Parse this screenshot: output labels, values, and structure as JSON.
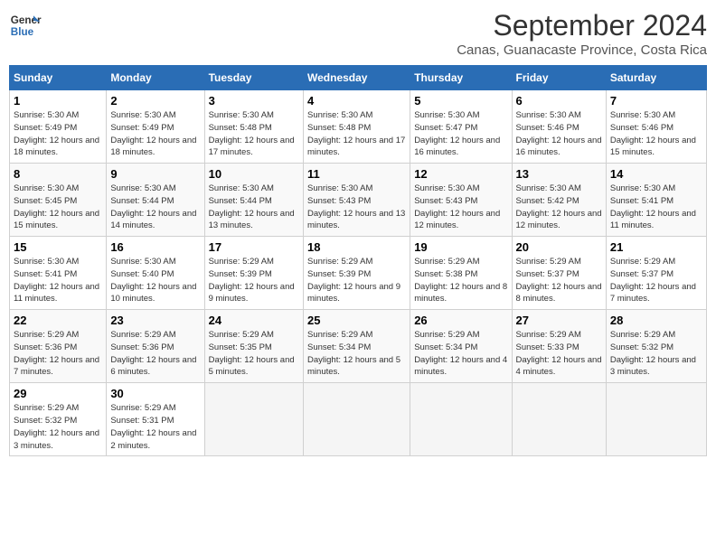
{
  "header": {
    "logo_line1": "General",
    "logo_line2": "Blue",
    "title": "September 2024",
    "subtitle": "Canas, Guanacaste Province, Costa Rica"
  },
  "calendar": {
    "days_of_week": [
      "Sunday",
      "Monday",
      "Tuesday",
      "Wednesday",
      "Thursday",
      "Friday",
      "Saturday"
    ],
    "weeks": [
      [
        {
          "day": "1",
          "sunrise": "5:30 AM",
          "sunset": "5:49 PM",
          "daylight": "12 hours and 18 minutes."
        },
        {
          "day": "2",
          "sunrise": "5:30 AM",
          "sunset": "5:49 PM",
          "daylight": "12 hours and 18 minutes."
        },
        {
          "day": "3",
          "sunrise": "5:30 AM",
          "sunset": "5:48 PM",
          "daylight": "12 hours and 17 minutes."
        },
        {
          "day": "4",
          "sunrise": "5:30 AM",
          "sunset": "5:48 PM",
          "daylight": "12 hours and 17 minutes."
        },
        {
          "day": "5",
          "sunrise": "5:30 AM",
          "sunset": "5:47 PM",
          "daylight": "12 hours and 16 minutes."
        },
        {
          "day": "6",
          "sunrise": "5:30 AM",
          "sunset": "5:46 PM",
          "daylight": "12 hours and 16 minutes."
        },
        {
          "day": "7",
          "sunrise": "5:30 AM",
          "sunset": "5:46 PM",
          "daylight": "12 hours and 15 minutes."
        }
      ],
      [
        {
          "day": "8",
          "sunrise": "5:30 AM",
          "sunset": "5:45 PM",
          "daylight": "12 hours and 15 minutes."
        },
        {
          "day": "9",
          "sunrise": "5:30 AM",
          "sunset": "5:44 PM",
          "daylight": "12 hours and 14 minutes."
        },
        {
          "day": "10",
          "sunrise": "5:30 AM",
          "sunset": "5:44 PM",
          "daylight": "12 hours and 13 minutes."
        },
        {
          "day": "11",
          "sunrise": "5:30 AM",
          "sunset": "5:43 PM",
          "daylight": "12 hours and 13 minutes."
        },
        {
          "day": "12",
          "sunrise": "5:30 AM",
          "sunset": "5:43 PM",
          "daylight": "12 hours and 12 minutes."
        },
        {
          "day": "13",
          "sunrise": "5:30 AM",
          "sunset": "5:42 PM",
          "daylight": "12 hours and 12 minutes."
        },
        {
          "day": "14",
          "sunrise": "5:30 AM",
          "sunset": "5:41 PM",
          "daylight": "12 hours and 11 minutes."
        }
      ],
      [
        {
          "day": "15",
          "sunrise": "5:30 AM",
          "sunset": "5:41 PM",
          "daylight": "12 hours and 11 minutes."
        },
        {
          "day": "16",
          "sunrise": "5:30 AM",
          "sunset": "5:40 PM",
          "daylight": "12 hours and 10 minutes."
        },
        {
          "day": "17",
          "sunrise": "5:29 AM",
          "sunset": "5:39 PM",
          "daylight": "12 hours and 9 minutes."
        },
        {
          "day": "18",
          "sunrise": "5:29 AM",
          "sunset": "5:39 PM",
          "daylight": "12 hours and 9 minutes."
        },
        {
          "day": "19",
          "sunrise": "5:29 AM",
          "sunset": "5:38 PM",
          "daylight": "12 hours and 8 minutes."
        },
        {
          "day": "20",
          "sunrise": "5:29 AM",
          "sunset": "5:37 PM",
          "daylight": "12 hours and 8 minutes."
        },
        {
          "day": "21",
          "sunrise": "5:29 AM",
          "sunset": "5:37 PM",
          "daylight": "12 hours and 7 minutes."
        }
      ],
      [
        {
          "day": "22",
          "sunrise": "5:29 AM",
          "sunset": "5:36 PM",
          "daylight": "12 hours and 7 minutes."
        },
        {
          "day": "23",
          "sunrise": "5:29 AM",
          "sunset": "5:36 PM",
          "daylight": "12 hours and 6 minutes."
        },
        {
          "day": "24",
          "sunrise": "5:29 AM",
          "sunset": "5:35 PM",
          "daylight": "12 hours and 5 minutes."
        },
        {
          "day": "25",
          "sunrise": "5:29 AM",
          "sunset": "5:34 PM",
          "daylight": "12 hours and 5 minutes."
        },
        {
          "day": "26",
          "sunrise": "5:29 AM",
          "sunset": "5:34 PM",
          "daylight": "12 hours and 4 minutes."
        },
        {
          "day": "27",
          "sunrise": "5:29 AM",
          "sunset": "5:33 PM",
          "daylight": "12 hours and 4 minutes."
        },
        {
          "day": "28",
          "sunrise": "5:29 AM",
          "sunset": "5:32 PM",
          "daylight": "12 hours and 3 minutes."
        }
      ],
      [
        {
          "day": "29",
          "sunrise": "5:29 AM",
          "sunset": "5:32 PM",
          "daylight": "12 hours and 3 minutes."
        },
        {
          "day": "30",
          "sunrise": "5:29 AM",
          "sunset": "5:31 PM",
          "daylight": "12 hours and 2 minutes."
        },
        null,
        null,
        null,
        null,
        null
      ]
    ]
  }
}
